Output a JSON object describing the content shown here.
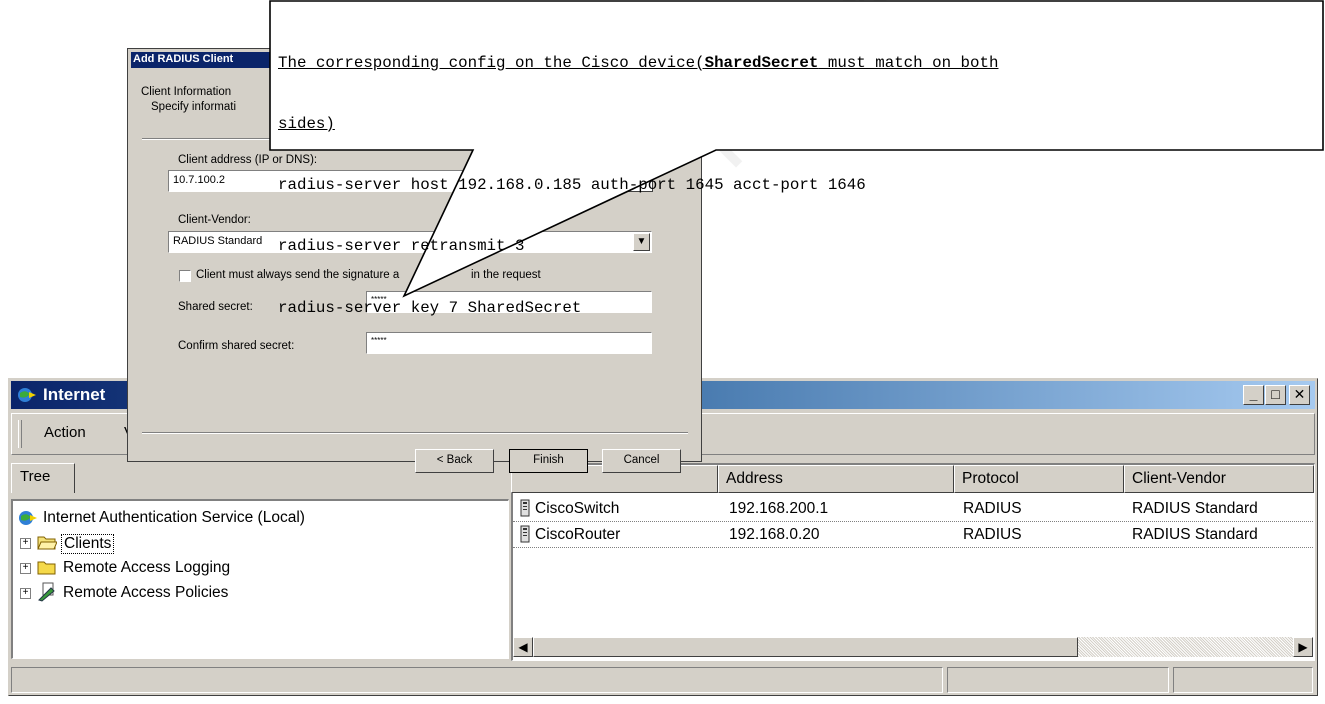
{
  "main_window": {
    "title": "Internet",
    "menu": {
      "action": "Action",
      "view_partial": "V"
    },
    "tree_tab": "Tree",
    "tree": [
      {
        "label": "Internet Authentication Service (Local)"
      },
      {
        "label": "Clients",
        "selected": true
      },
      {
        "label": "Remote Access Logging"
      },
      {
        "label": "Remote Access Policies"
      }
    ],
    "columns": [
      "Address",
      "Protocol",
      "Client-Vendor"
    ],
    "rows": [
      {
        "name": "CiscoSwitch",
        "address": "192.168.200.1",
        "protocol": "RADIUS",
        "vendor": "RADIUS Standard"
      },
      {
        "name": "CiscoRouter",
        "address": "192.168.0.20",
        "protocol": "RADIUS",
        "vendor": "RADIUS Standard"
      }
    ]
  },
  "dialog": {
    "title": "Add RADIUS Client",
    "section_title": "Client Information",
    "section_subtitle": "Specify informati",
    "client_address_label": "Client address (IP or DNS):",
    "client_address_value": "10.7.100.2",
    "vendor_label": "Client-Vendor:",
    "vendor_value": "RADIUS Standard",
    "checkbox_label_a": "Client must always send the signature a",
    "checkbox_label_b": "in the request",
    "shared_secret_label": "Shared secret:",
    "shared_secret_value": "*****",
    "confirm_label": "Confirm shared secret:",
    "confirm_value": "*****",
    "back_label": "< Back",
    "finish_label": "Finish",
    "cancel_label": "Cancel"
  },
  "callout": {
    "line1_a": "The corresponding config on the Cisco device(",
    "line1_bold": "SharedSecret",
    "line1_b": " must match on both",
    "line2": "sides)",
    "line3": "radius-server host 192.168.0.185 auth-port 1645 acct-port 1646",
    "line4": "radius-server retransmit 3",
    "line5": "radius-server key 7 SharedSecret"
  },
  "watermark": "full rights",
  "colors": {
    "titlebar_start": "#0a246a",
    "titlebar_end": "#a6caf0",
    "chrome": "#d4d0c8"
  }
}
